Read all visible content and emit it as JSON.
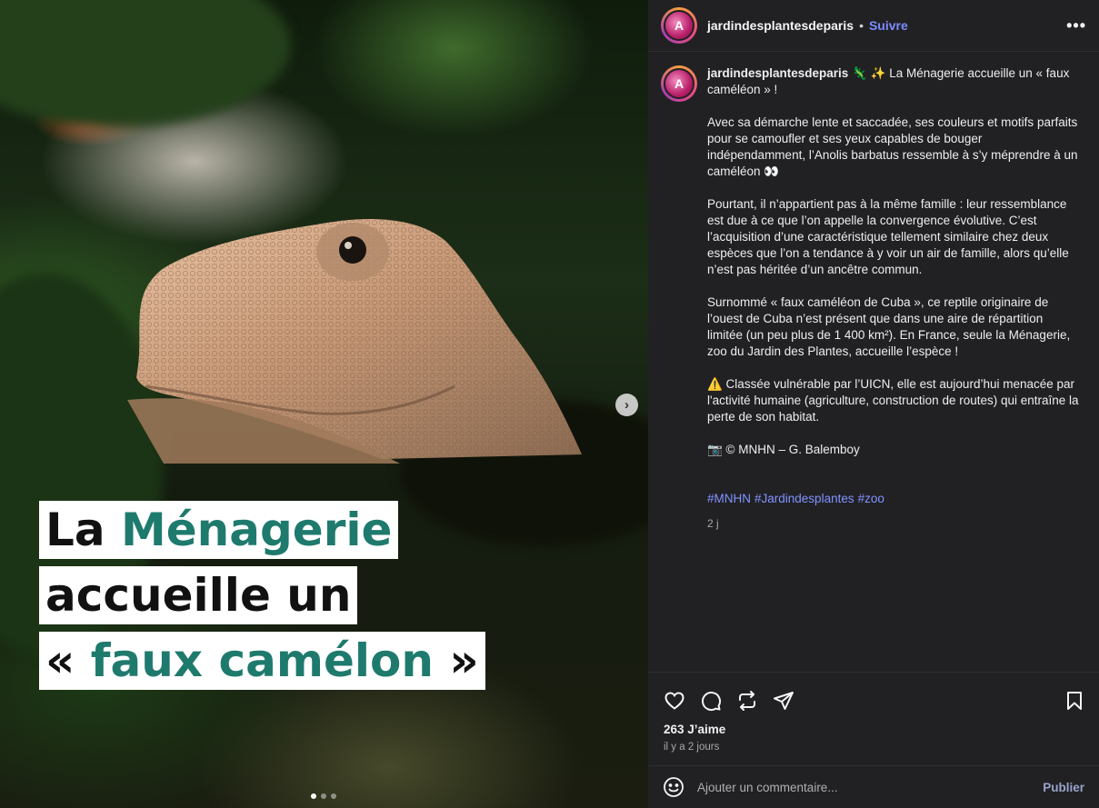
{
  "post": {
    "username": "jardindesplantesdeparis",
    "separator": "•",
    "follow_label": "Suivre",
    "more_label": "•••",
    "avatar_letter": "A",
    "media": {
      "caption_line1_plain": "La ",
      "caption_line1_accent": "Ménagerie",
      "caption_line2": "accueille un",
      "caption_line3_open": "« ",
      "caption_line3_accent": "faux camélon",
      "caption_line3_close": " »",
      "next_label": "›",
      "slide_count": 3,
      "active_slide": 1,
      "accent_color": "#1f7a6e"
    },
    "caption": {
      "intro": "🦎 ✨ La Ménagerie accueille un « faux caméléon » !",
      "paragraphs": [
        "Avec sa démarche lente et saccadée, ses couleurs et motifs parfaits pour se camoufler et ses yeux capables de bouger indépendamment, l’Anolis barbatus ressemble à s’y méprendre à un caméléon 👀",
        "Pourtant, il n’appartient pas à la même famille : leur ressemblance est due à ce que l’on appelle la convergence évolutive. C’est l’acquisition d’une caractéristique tellement similaire chez deux espèces que l’on a tendance à y voir un air de famille, alors qu’elle n’est pas héritée d’un ancêtre commun.",
        "Surnommé « faux caméléon de Cuba », ce reptile originaire de l’ouest de Cuba n’est présent que dans une aire de répartition limitée (un peu plus de 1 400 km²). En France, seule la Ménagerie, zoo du Jardin des Plantes, accueille l’espèce !",
        "⚠️ Classée vulnérable par l’UICN, elle est aujourd’hui menacée par l'activité humaine (agriculture, construction de routes) qui entraîne la perte de son habitat.",
        "📷 © MNHN – G. Balemboy"
      ],
      "hashtags": [
        "#MNHN",
        "#Jardindesplantes",
        "#zoo"
      ],
      "time_ago": "2 j"
    },
    "actions": {
      "like_icon": "heart-icon",
      "comment_icon": "comment-icon",
      "share_icon": "repost-icon",
      "send_icon": "send-icon",
      "save_icon": "bookmark-icon"
    },
    "likes": "263 J’aime",
    "date": "il y a 2 jours",
    "comment_placeholder": "Ajouter un commentaire...",
    "publish_label": "Publier",
    "colors": {
      "panel_bg": "#212124",
      "link": "#7b8cff"
    }
  }
}
